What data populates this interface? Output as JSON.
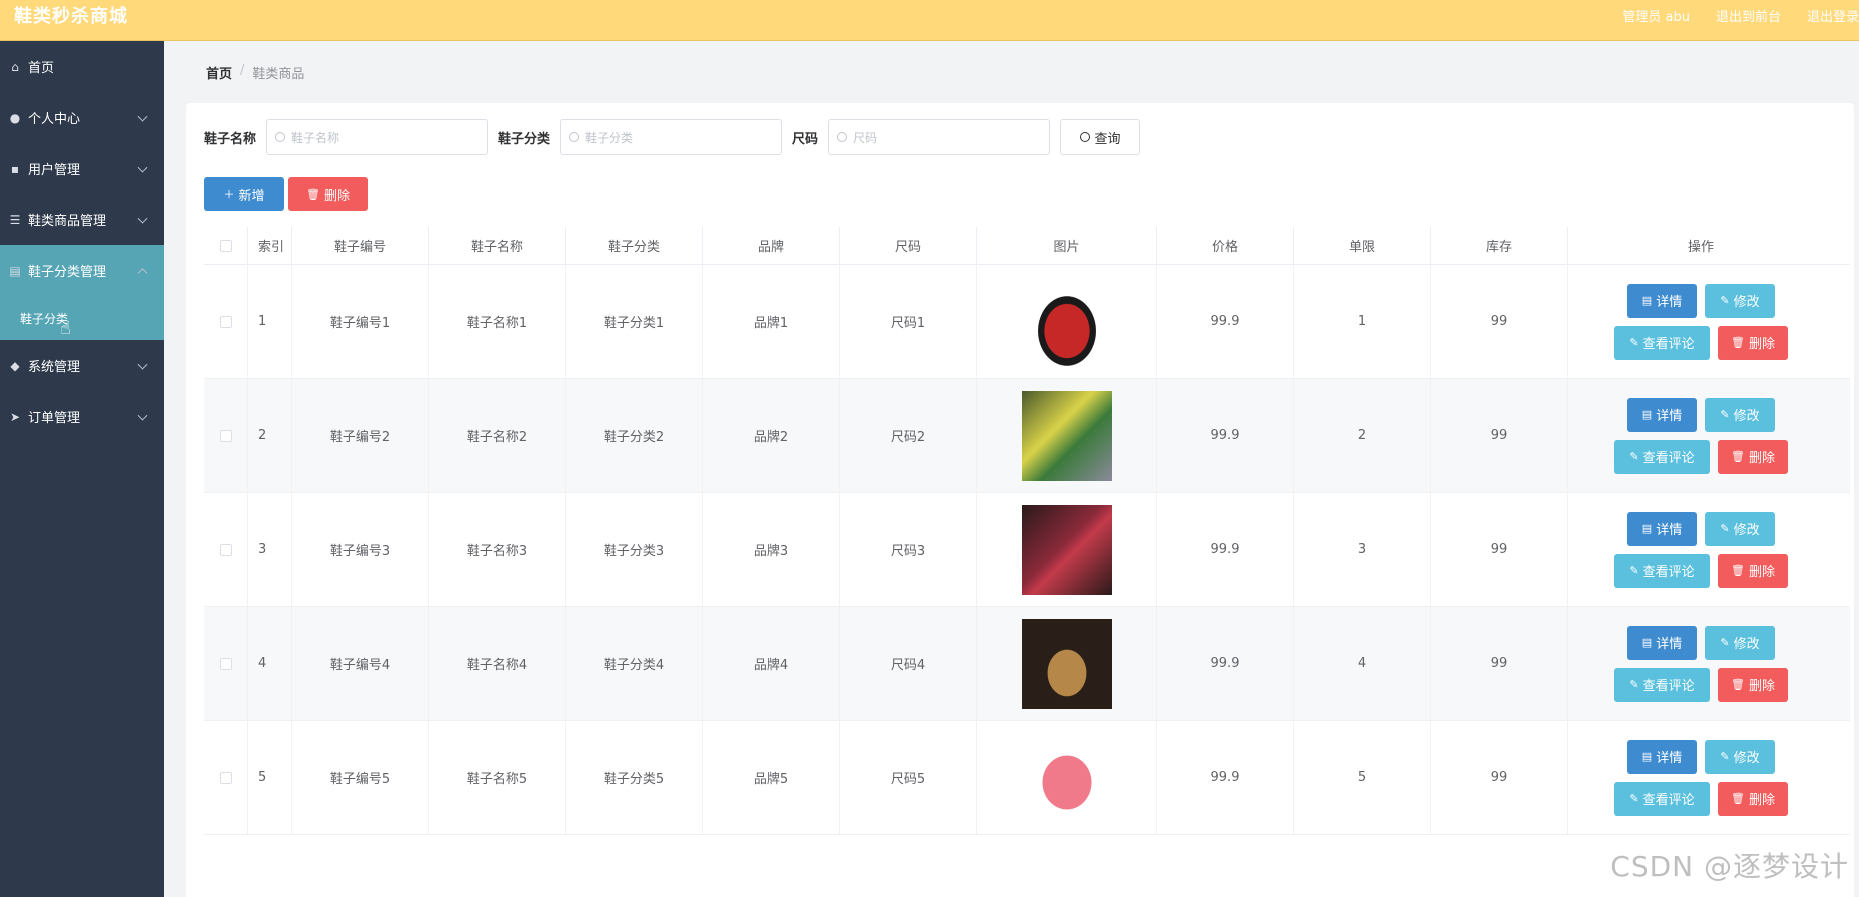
{
  "app": {
    "title": "鞋类秒杀商城",
    "admin_label": "管理员 abu",
    "to_front": "退出到前台",
    "logout": "退出登录"
  },
  "sidebar": {
    "items": [
      {
        "label": "首页",
        "icon": "home-icon"
      },
      {
        "label": "个人中心",
        "icon": "user-icon"
      },
      {
        "label": "用户管理",
        "icon": "chat-icon"
      },
      {
        "label": "鞋类商品管理",
        "icon": "list-icon"
      },
      {
        "label": "鞋子分类管理",
        "icon": "category-icon"
      },
      {
        "label": "系统管理",
        "icon": "location-icon"
      },
      {
        "label": "订单管理",
        "icon": "send-icon"
      }
    ],
    "submenu": {
      "label": "鞋子分类"
    }
  },
  "breadcrumb": {
    "home": "首页",
    "sep": "/",
    "current": "鞋类商品"
  },
  "search": {
    "name_label": "鞋子名称",
    "name_placeholder": "鞋子名称",
    "category_label": "鞋子分类",
    "category_placeholder": "鞋子分类",
    "size_label": "尺码",
    "size_placeholder": "尺码",
    "query_button": "查询"
  },
  "actions": {
    "add": "新增",
    "delete": "删除"
  },
  "table": {
    "columns": [
      "索引",
      "鞋子编号",
      "鞋子名称",
      "鞋子分类",
      "品牌",
      "尺码",
      "图片",
      "价格",
      "单限",
      "库存",
      "操作"
    ],
    "rows": [
      {
        "idx": "1",
        "code": "鞋子编号1",
        "name": "鞋子名称1",
        "category": "鞋子分类1",
        "brand": "品牌1",
        "size": "尺码1",
        "price": "99.9",
        "limit": "1",
        "stock": "99"
      },
      {
        "idx": "2",
        "code": "鞋子编号2",
        "name": "鞋子名称2",
        "category": "鞋子分类2",
        "brand": "品牌2",
        "size": "尺码2",
        "price": "99.9",
        "limit": "2",
        "stock": "99"
      },
      {
        "idx": "3",
        "code": "鞋子编号3",
        "name": "鞋子名称3",
        "category": "鞋子分类3",
        "brand": "品牌3",
        "size": "尺码3",
        "price": "99.9",
        "limit": "3",
        "stock": "99"
      },
      {
        "idx": "4",
        "code": "鞋子编号4",
        "name": "鞋子名称4",
        "category": "鞋子分类4",
        "brand": "品牌4",
        "size": "尺码4",
        "price": "99.9",
        "limit": "4",
        "stock": "99"
      },
      {
        "idx": "5",
        "code": "鞋子编号5",
        "name": "鞋子名称5",
        "category": "鞋子分类5",
        "brand": "品牌5",
        "size": "尺码5",
        "price": "99.9",
        "limit": "5",
        "stock": "99"
      }
    ],
    "op_labels": {
      "detail": "详情",
      "edit": "修改",
      "comment": "查看评论",
      "delete": "删除"
    }
  },
  "watermark": "CSDN @逐梦设计"
}
